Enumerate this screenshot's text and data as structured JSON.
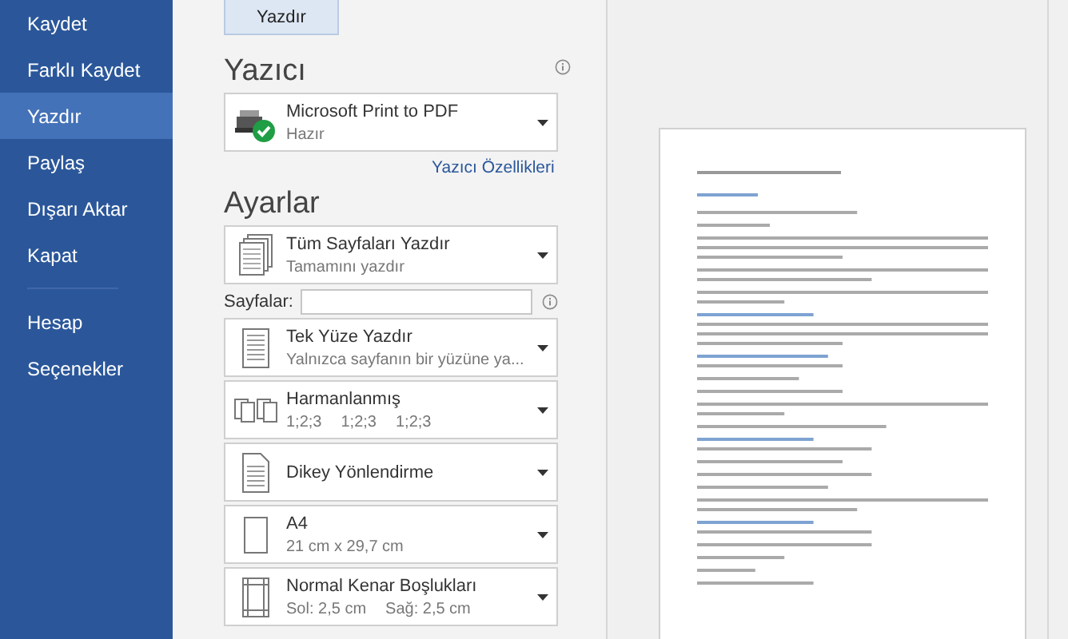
{
  "sidebar": {
    "items": [
      {
        "label": "Kaydet",
        "selected": false
      },
      {
        "label": "Farklı Kaydet",
        "selected": false
      },
      {
        "label": "Yazdır",
        "selected": true
      },
      {
        "label": "Paylaş",
        "selected": false
      },
      {
        "label": "Dışarı Aktar",
        "selected": false
      },
      {
        "label": "Kapat",
        "selected": false
      }
    ],
    "bottom_items": [
      {
        "label": "Hesap",
        "selected": false
      },
      {
        "label": "Seçenekler",
        "selected": false
      }
    ]
  },
  "print_button": {
    "label": "Yazdır"
  },
  "printer": {
    "heading": "Yazıcı",
    "name": "Microsoft Print to PDF",
    "status": "Hazır",
    "properties_link": "Yazıcı Özellikleri"
  },
  "settings": {
    "heading": "Ayarlar",
    "dropdowns_top": [
      {
        "kind": "pages",
        "title": "Tüm Sayfaları Yazdır",
        "subtitle": "Tamamını yazdır"
      }
    ],
    "pages_field": {
      "label": "Sayfalar:"
    },
    "dropdowns": [
      {
        "kind": "one-sided",
        "title": "Tek Yüze Yazdır",
        "subtitle": "Yalnızca sayfanın bir yüzüne ya..."
      },
      {
        "kind": "collated",
        "title": "Harmanlanmış",
        "subtitle_parts": [
          "1;2;3",
          "1;2;3",
          "1;2;3"
        ]
      },
      {
        "kind": "portrait",
        "title": "Dikey Yönlendirme"
      },
      {
        "kind": "paper",
        "title": "A4",
        "subtitle": "21 cm x 29,7 cm"
      },
      {
        "kind": "margins",
        "title": "Normal Kenar Boşlukları",
        "subtitle_parts": [
          "Sol: 2,5 cm",
          "Sağ: 2,5 cm"
        ]
      }
    ]
  },
  "preview": {
    "kind": "document-page"
  }
}
